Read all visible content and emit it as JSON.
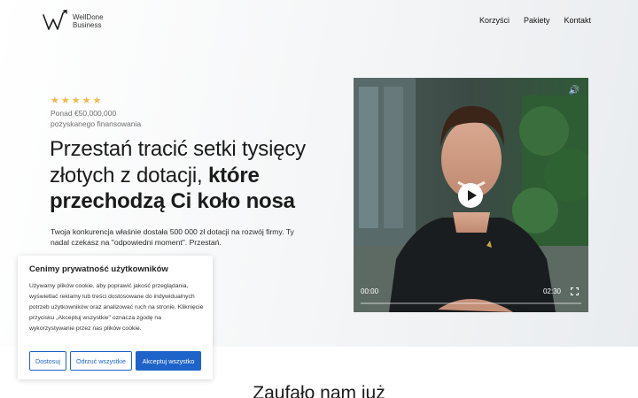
{
  "brand": {
    "line1": "WellDone",
    "line2": "Business"
  },
  "nav": [
    "Korzyści",
    "Pakiety",
    "Kontakt"
  ],
  "hero": {
    "rating_stars": 5,
    "raised_line1": "Ponad €50,000,000",
    "raised_line2": "pozyskanego finansowania",
    "headline_regular": "Przestań tracić setki tysięcy złotych z dotacji, ",
    "headline_bold": "które przechodzą Ci koło nosa",
    "subtext": "Twoja konkurencja właśnie dostała 500 000 zł dotacji na rozwój firmy. Ty nadal czekasz na \"odpowiedni moment\". Przestań."
  },
  "video": {
    "current_time": "00:00",
    "duration": "02:30",
    "progress": 0
  },
  "cookie_banner": {
    "title": "Cenimy prywatność użytkowników",
    "text": "Używamy plików cookie, aby poprawić jakość przeglądania, wyświetlać reklamy lub treści dostosowane do indywidualnych potrzeb użytkowników oraz analizować ruch na stronie. Kliknięcie przycisku „Akceptuj wszystkie\" oznacza zgodę na wykorzystywanie przez nas plików cookie.",
    "customize_label": "Dostosuj",
    "reject_label": "Odrzuć wszystkie",
    "accept_label": "Akceptuj wszystko",
    "accent_color": "#1e63c9"
  },
  "trusted_heading": "Zaufało nam już"
}
